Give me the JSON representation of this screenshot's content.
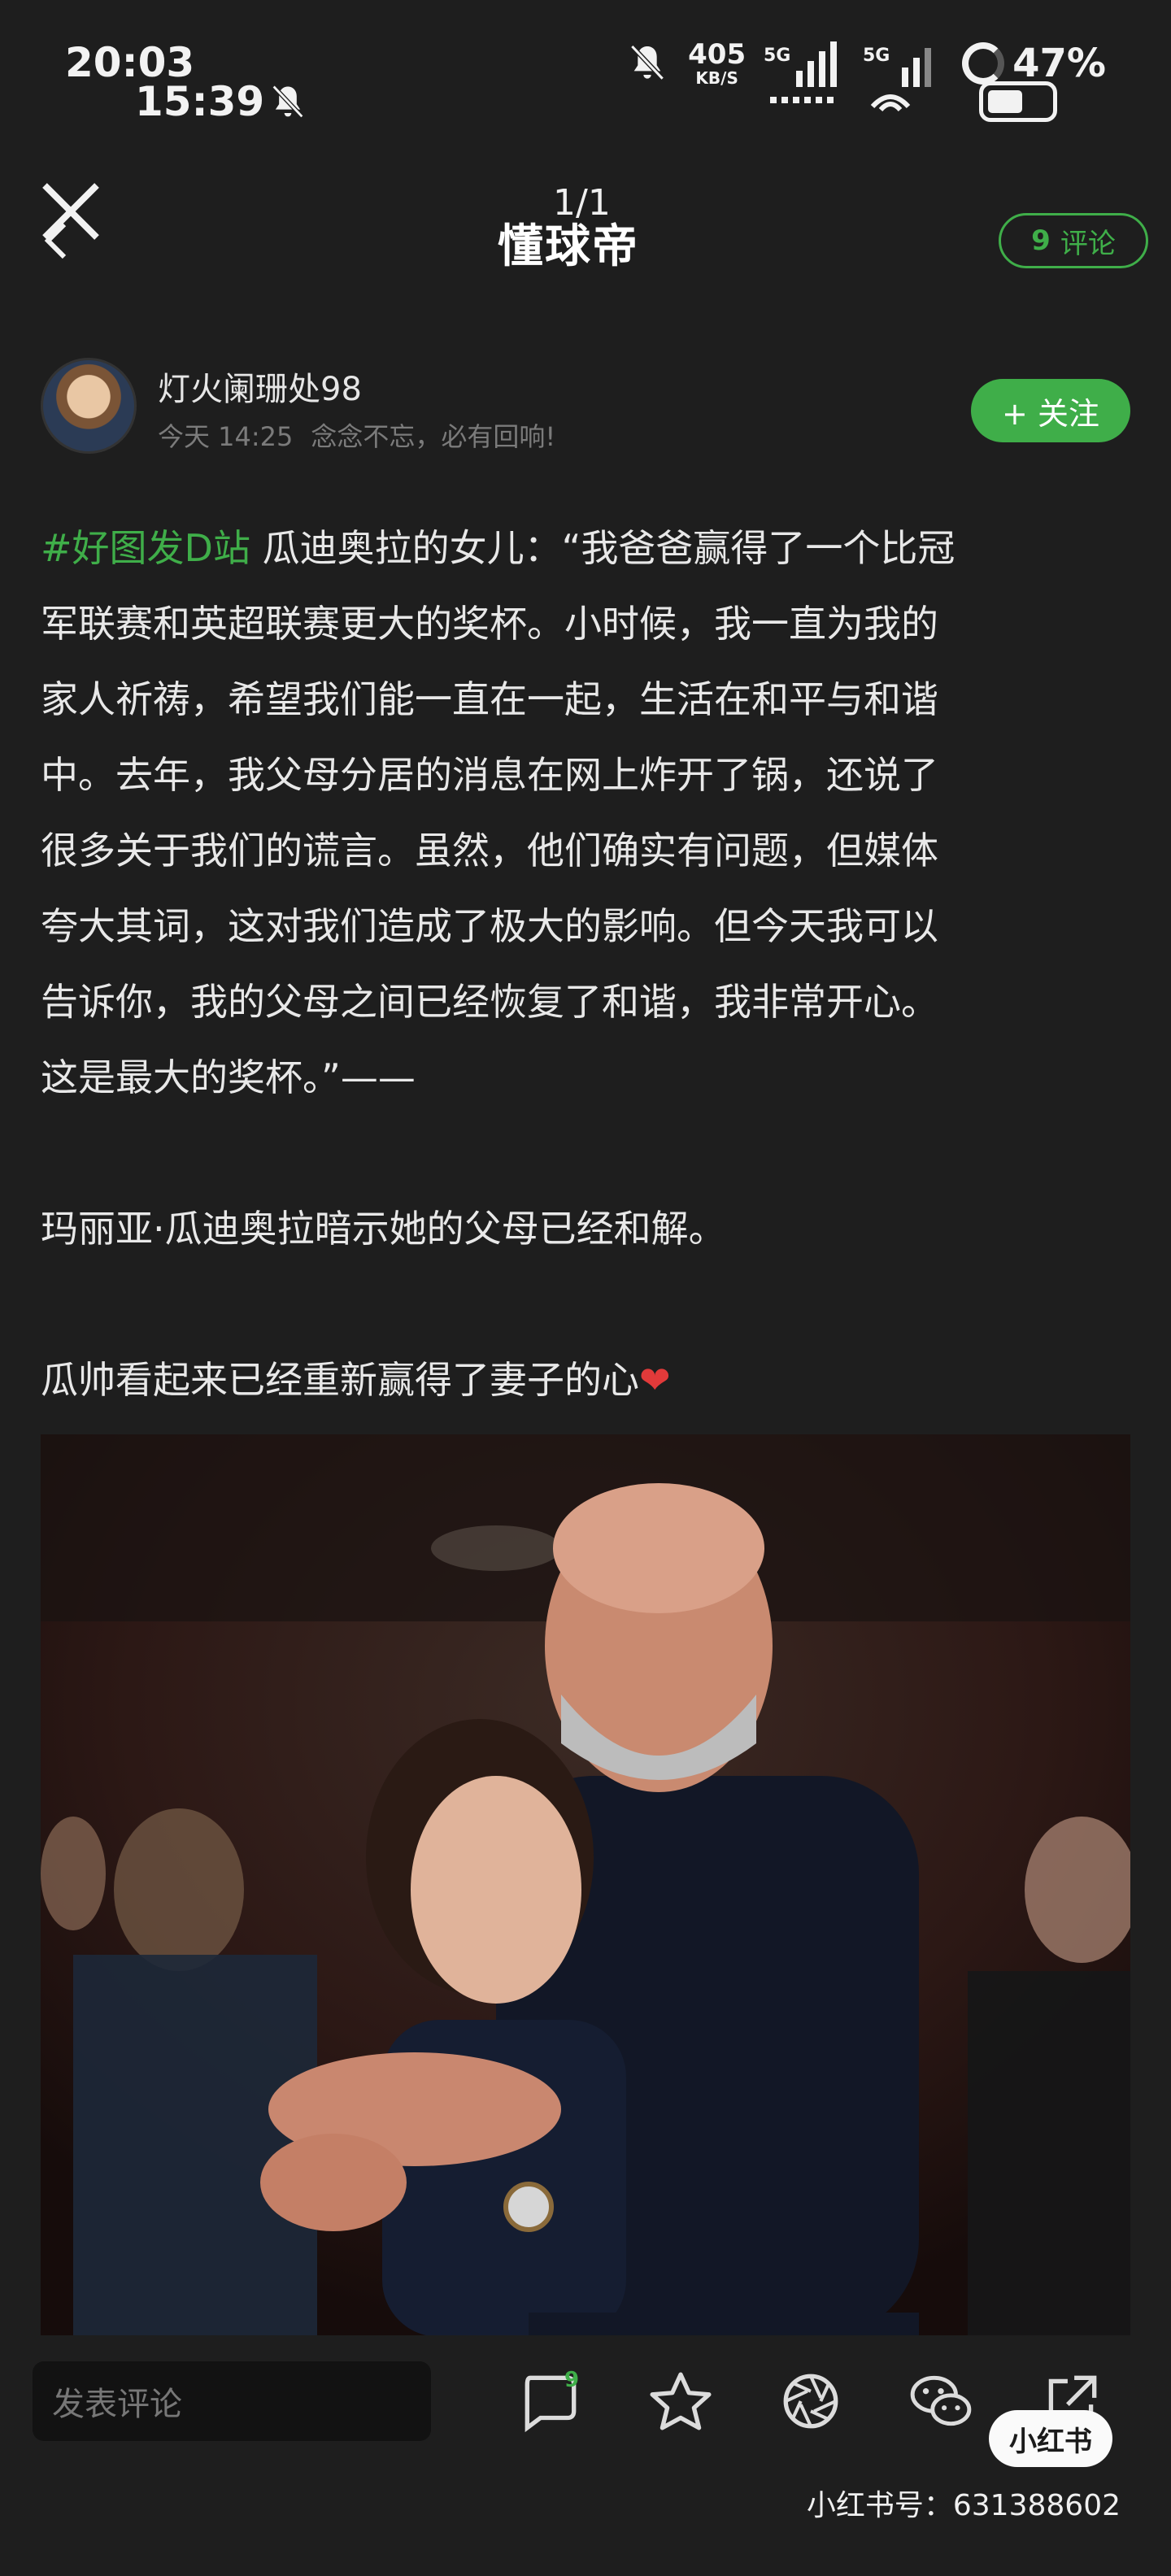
{
  "status_bar": {
    "time_primary": "20:03",
    "time_secondary": "15:39",
    "net_speed_value": "405",
    "net_speed_unit": "KB/S",
    "signal_1": "5G",
    "signal_2": "5G",
    "battery_percent": "47%"
  },
  "header": {
    "page_count": "1/1",
    "logo_text": "懂球帝",
    "comments_count": "9",
    "comments_label": "评论"
  },
  "author": {
    "name": "灯火阑珊处98",
    "date": "今天 14:25",
    "signature": "念念不忘，必有回响!",
    "follow_label": "+ 关注"
  },
  "post": {
    "hashtag": "#好图发D站",
    "line1": " 瓜迪奥拉的女儿：“我爸爸赢得了一个比冠",
    "line2": "军联赛和英超联赛更大的奖杯。小时候，我一直为我的",
    "line3": "家人祈祷，希望我们能一直在一起，生活在和平与和谐",
    "line4": "中。去年，我父母分居的消息在网上炸开了锅，还说了",
    "line5": "很多关于我们的谎言。虽然，他们确实有问题，但媒体",
    "line6": "夸大其词，这对我们造成了极大的影响。但今天我可以",
    "line7": "告诉你，我的父母之间已经恢复了和谐，我非常开心。",
    "line8": "这是最大的奖杯。”——",
    "para2": "玛丽亚·瓜迪奥拉暗示她的父母已经和解。",
    "para3": "瓜帅看起来已经重新赢得了妻子的心",
    "emoji": "❤"
  },
  "bottom": {
    "comment_placeholder": "发表评论",
    "comment_badge": "9",
    "watermark_logo": "小红书",
    "watermark_id": "小红书号：631388602"
  }
}
